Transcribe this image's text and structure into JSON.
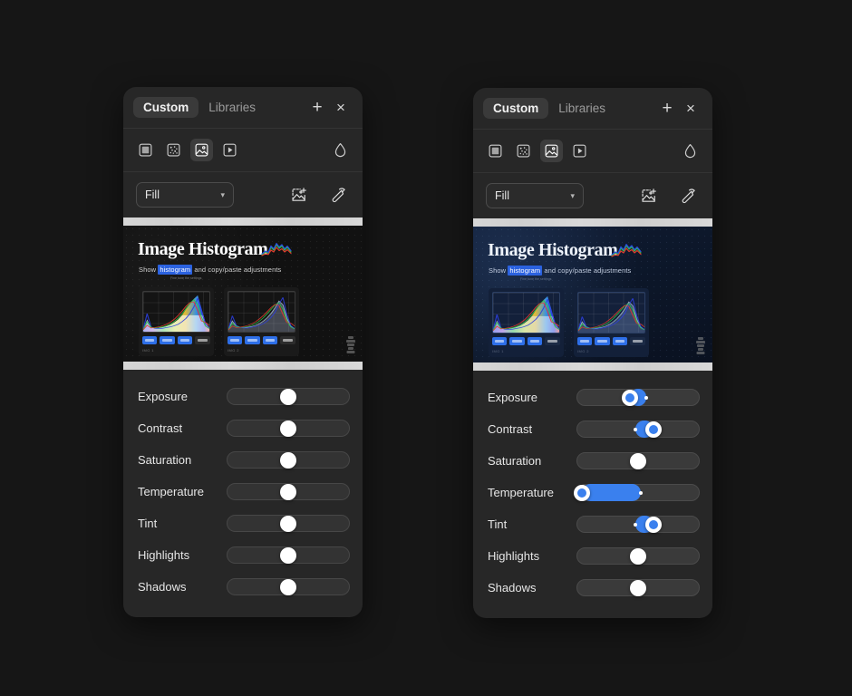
{
  "theme": {
    "page_bg": "#161616",
    "panel_bg": "#272727",
    "accent": "#3a80ee",
    "highlight": "#2b62e0",
    "text": "#e6e6e6"
  },
  "panels": [
    {
      "id": "left",
      "variant": "neutral",
      "tabs": [
        {
          "label": "Custom",
          "active": true
        },
        {
          "label": "Libraries",
          "active": false
        }
      ],
      "header_actions": [
        {
          "name": "add-icon",
          "glyph": "+"
        },
        {
          "name": "close-icon",
          "glyph": "×"
        }
      ],
      "tools": [
        {
          "name": "frame-icon",
          "active": false
        },
        {
          "name": "noise-icon",
          "active": false
        },
        {
          "name": "image-icon",
          "active": true
        },
        {
          "name": "video-icon",
          "active": false
        }
      ],
      "tool_right": {
        "name": "droplet-icon"
      },
      "select": {
        "label": "Fill",
        "caret": "▾"
      },
      "select_actions": [
        {
          "name": "add-image-icon"
        },
        {
          "name": "eyedropper-icon"
        }
      ],
      "preview": {
        "title": "Image Histogram",
        "subtitle_pre": "Show ",
        "subtitle_highlight": "histogram",
        "subtitle_post": " and copy/paste adjustments",
        "caption_small": "Fine tune the settings",
        "thumbnails": [
          {
            "caption": "IMG 1",
            "style": "color"
          },
          {
            "caption": "IMG 2",
            "style": "line"
          }
        ]
      },
      "sliders": [
        {
          "label": "Exposure",
          "value": 50,
          "fill": false
        },
        {
          "label": "Contrast",
          "value": 50,
          "fill": false
        },
        {
          "label": "Saturation",
          "value": 50,
          "fill": false
        },
        {
          "label": "Temperature",
          "value": 50,
          "fill": false
        },
        {
          "label": "Tint",
          "value": 50,
          "fill": false
        },
        {
          "label": "Highlights",
          "value": 50,
          "fill": false
        },
        {
          "label": "Shadows",
          "value": 50,
          "fill": false
        }
      ]
    },
    {
      "id": "right",
      "variant": "blue",
      "tabs": [
        {
          "label": "Custom",
          "active": true
        },
        {
          "label": "Libraries",
          "active": false
        }
      ],
      "header_actions": [
        {
          "name": "add-icon",
          "glyph": "+"
        },
        {
          "name": "close-icon",
          "glyph": "×"
        }
      ],
      "tools": [
        {
          "name": "frame-icon",
          "active": false
        },
        {
          "name": "noise-icon",
          "active": false
        },
        {
          "name": "image-icon",
          "active": true
        },
        {
          "name": "video-icon",
          "active": false
        }
      ],
      "tool_right": {
        "name": "droplet-icon"
      },
      "select": {
        "label": "Fill",
        "caret": "▾"
      },
      "select_actions": [
        {
          "name": "add-image-icon"
        },
        {
          "name": "eyedropper-icon"
        }
      ],
      "preview": {
        "title": "Image Histogram",
        "subtitle_pre": "Show ",
        "subtitle_highlight": "histogram",
        "subtitle_post": " and copy/paste adjustments",
        "caption_small": "Fine tune the settings",
        "thumbnails": [
          {
            "caption": "IMG 1",
            "style": "color"
          },
          {
            "caption": "IMG 2",
            "style": "line"
          }
        ]
      },
      "sliders": [
        {
          "label": "Exposure",
          "value": 43,
          "fill": true,
          "fill_from": 43,
          "fill_to": 57,
          "origin_dot": 57
        },
        {
          "label": "Contrast",
          "value": 63,
          "fill": true,
          "fill_from": 48,
          "fill_to": 63,
          "origin_dot": 48
        },
        {
          "label": "Saturation",
          "value": 50,
          "fill": false
        },
        {
          "label": "Temperature",
          "value": 4,
          "fill": true,
          "fill_from": 4,
          "fill_to": 52,
          "origin_dot": 52
        },
        {
          "label": "Tint",
          "value": 63,
          "fill": true,
          "fill_from": 48,
          "fill_to": 63,
          "origin_dot": 48
        },
        {
          "label": "Highlights",
          "value": 50,
          "fill": false
        },
        {
          "label": "Shadows",
          "value": 50,
          "fill": false
        }
      ]
    }
  ],
  "chart_data": {
    "type": "area",
    "title": "Image Histogram",
    "charts": [
      {
        "name": "IMG 1",
        "xlabel": "",
        "ylabel": "",
        "xlim": [
          0,
          255
        ],
        "ylim": [
          0,
          100
        ],
        "grid": true,
        "series": [
          {
            "name": "Luminance",
            "color": "#ffffff",
            "values": [
              2,
              30,
              8,
              6,
              7,
              9,
              12,
              16,
              22,
              30,
              42,
              58,
              72,
              86,
              96,
              60,
              22,
              8
            ]
          },
          {
            "name": "Blue",
            "color": "#2b3fe0",
            "values": [
              3,
              46,
              10,
              6,
              5,
              6,
              8,
              10,
              13,
              17,
              24,
              33,
              46,
              64,
              88,
              52,
              18,
              6
            ]
          },
          {
            "name": "Green",
            "color": "#2fc24a",
            "values": [
              2,
              24,
              9,
              7,
              8,
              10,
              13,
              18,
              25,
              34,
              46,
              60,
              74,
              84,
              70,
              36,
              12,
              5
            ]
          },
          {
            "name": "Red",
            "color": "#e23a2e",
            "values": [
              2,
              14,
              7,
              8,
              10,
              13,
              17,
              23,
              31,
              41,
              53,
              66,
              76,
              78,
              54,
              26,
              22,
              14
            ]
          }
        ]
      },
      {
        "name": "IMG 2",
        "xlabel": "",
        "ylabel": "",
        "xlim": [
          0,
          255
        ],
        "ylim": [
          0,
          100
        ],
        "grid": true,
        "series": [
          {
            "name": "Luminance",
            "color": "#9fb6d6",
            "values": [
              2,
              26,
              12,
              9,
              8,
              9,
              11,
              14,
              19,
              26,
              35,
              47,
              62,
              80,
              70,
              34,
              12,
              5
            ]
          },
          {
            "name": "Blue",
            "color": "#2b3fe0",
            "values": [
              3,
              40,
              14,
              9,
              7,
              7,
              9,
              11,
              14,
              19,
              26,
              36,
              50,
              72,
              90,
              44,
              14,
              5
            ]
          },
          {
            "name": "Green",
            "color": "#2fc24a",
            "values": [
              2,
              20,
              11,
              9,
              9,
              11,
              14,
              19,
              26,
              35,
              46,
              58,
              70,
              76,
              58,
              28,
              10,
              4
            ]
          },
          {
            "name": "Red",
            "color": "#e23a2e",
            "values": [
              2,
              12,
              8,
              9,
              11,
              14,
              18,
              24,
              32,
              41,
              52,
              63,
              71,
              68,
              44,
              22,
              20,
              12
            ]
          }
        ]
      }
    ]
  }
}
